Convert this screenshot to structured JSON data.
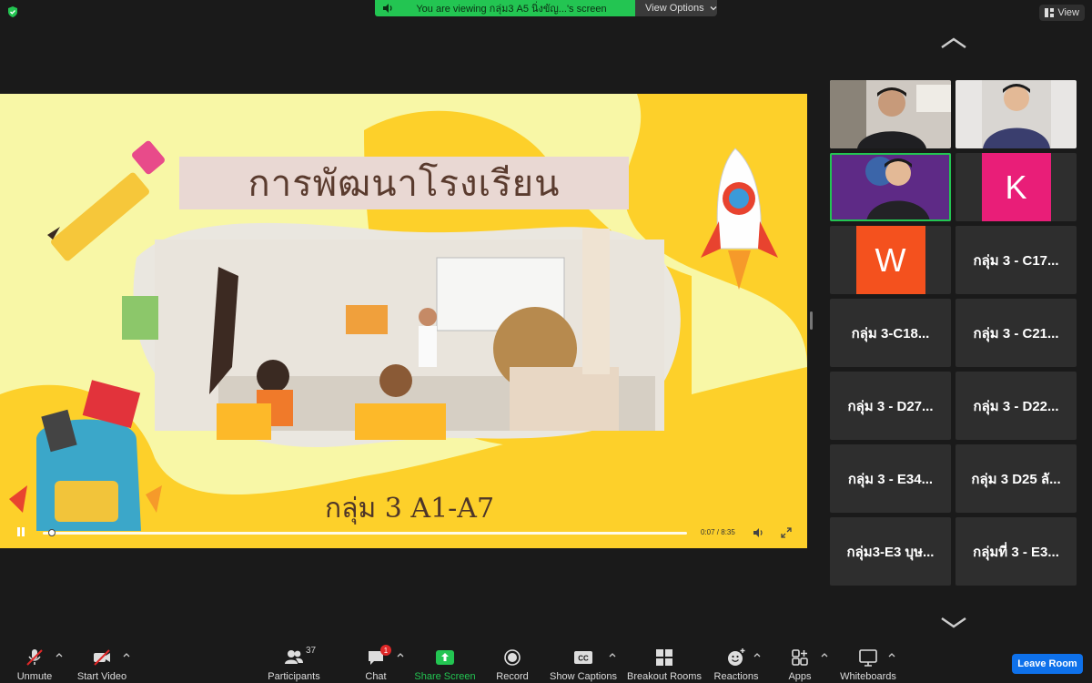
{
  "top": {
    "viewing_text": "You are viewing กลุ่ม3 A5 นิ่งขัญ...'s screen",
    "view_options": "View Options",
    "view": "View"
  },
  "slide": {
    "title": "การพัฒนาโรงเรียน",
    "subtitle": "กลุ่ม 3 A1-A7"
  },
  "player": {
    "time": "0:07 / 8:35",
    "progress": 0.014
  },
  "gallery": [
    {
      "name": "",
      "kind": "video"
    },
    {
      "name": "",
      "kind": "video"
    },
    {
      "name": "",
      "kind": "video",
      "active": true
    },
    {
      "name": "K",
      "kind": "letter",
      "color": "#e91e78"
    },
    {
      "name": "W",
      "kind": "letter",
      "color": "#f4511e"
    },
    {
      "name": "กลุ่ม 3 - C17...",
      "kind": "name"
    },
    {
      "name": "กลุ่ม 3-C18...",
      "kind": "name"
    },
    {
      "name": "กลุ่ม 3 - C21...",
      "kind": "name"
    },
    {
      "name": "กลุ่ม 3 - D27...",
      "kind": "name"
    },
    {
      "name": "กลุ่ม 3 - D22...",
      "kind": "name"
    },
    {
      "name": "กลุ่ม 3 - E34...",
      "kind": "name"
    },
    {
      "name": "กลุ่ม 3 D25 ลั...",
      "kind": "name"
    },
    {
      "name": "กลุ่ม3-E3 บุษ...",
      "kind": "name"
    },
    {
      "name": "กลุ่มที่ 3 - E3...",
      "kind": "name"
    }
  ],
  "toolbar": {
    "unmute": "Unmute",
    "start_video": "Start Video",
    "participants": "Participants",
    "participants_count": "37",
    "chat": "Chat",
    "chat_badge": "1",
    "share_screen": "Share Screen",
    "record": "Record",
    "show_captions": "Show Captions",
    "breakout_rooms": "Breakout Rooms",
    "reactions": "Reactions",
    "apps": "Apps",
    "whiteboards": "Whiteboards",
    "leave": "Leave Room"
  },
  "colors": {
    "accent_green": "#23c552",
    "leave_blue": "#0e71eb",
    "slide_yellow": "#fdd02a"
  }
}
